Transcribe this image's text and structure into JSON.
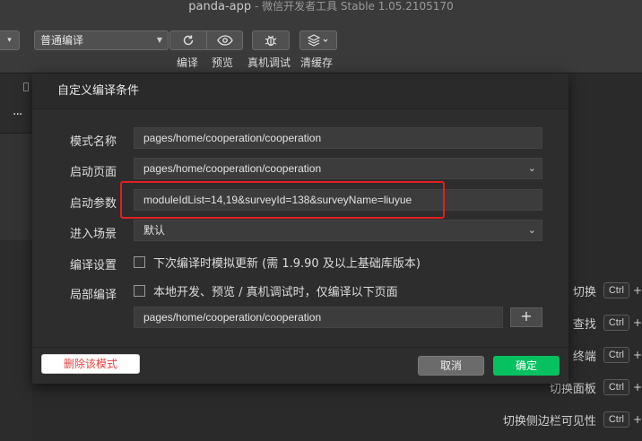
{
  "window": {
    "app_name": "panda-app",
    "subtitle": " - 微信开发者工具 Stable 1.05.2105170"
  },
  "toolbar": {
    "mode_select_value": "普通编译",
    "compile_label": "编译",
    "preview_label": "预览",
    "device_debug_label": "真机调试",
    "clear_cache_label": "清缓存"
  },
  "icons": {
    "compile": "refresh-icon",
    "preview": "eye-icon",
    "device_debug": "bug-icon",
    "clear_cache": "layers-icon"
  },
  "dialog": {
    "title": "自定义编译条件",
    "mode_name_label": "模式名称",
    "mode_name_value": "pages/home/cooperation/cooperation",
    "start_page_label": "启动页面",
    "start_page_value": "pages/home/cooperation/cooperation",
    "start_params_label": "启动参数",
    "start_params_value": "moduleIdList=14,19&surveyId=138&surveyName=liuyue",
    "scene_label": "进入场景",
    "scene_value": "默认",
    "compile_settings_label": "编译设置",
    "compile_settings_option": "下次编译时模拟更新 (需 1.9.90 及以上基础库版本)",
    "partial_compile_label": "局部编译",
    "partial_compile_option": "本地开发、预览 / 真机调试时，仅编译以下页面",
    "partial_compile_page": "pages/home/cooperation/cooperation",
    "add_label": "+",
    "delete_mode_label": "删除该模式",
    "cancel_label": "取消",
    "confirm_label": "确定"
  },
  "shortcuts": [
    {
      "label": "切换",
      "key": "Ctrl",
      "plus": "+"
    },
    {
      "label": "查找",
      "key": "Ctrl",
      "plus": "+"
    },
    {
      "label": "终端",
      "key": "Ctrl",
      "plus": "+"
    },
    {
      "label": "切换面板",
      "key": "Ctrl",
      "plus": "+"
    },
    {
      "label": "切换侧边栏可见性",
      "key": "Ctrl",
      "plus": "+"
    }
  ],
  "colors": {
    "confirm": "#07c160",
    "delete_text": "#e64340",
    "highlight": "#e02020"
  }
}
